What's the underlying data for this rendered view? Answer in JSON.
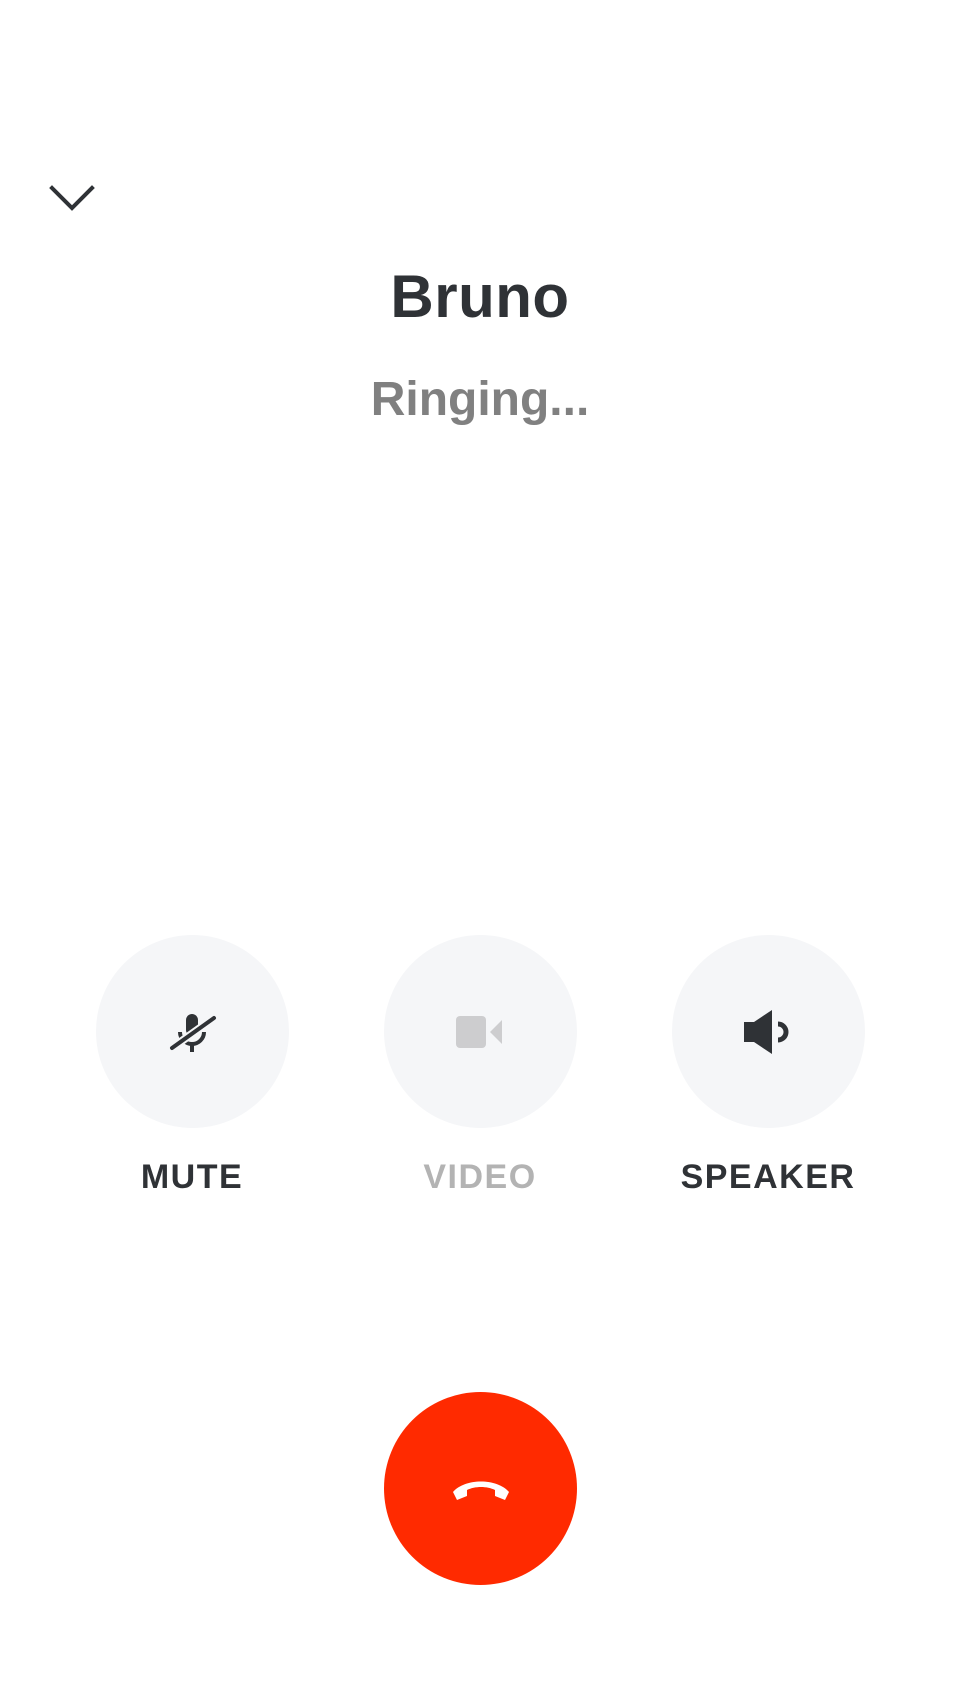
{
  "call": {
    "caller_name": "Bruno",
    "status": "Ringing..."
  },
  "controls": {
    "mute_label": "MUTE",
    "video_label": "VIDEO",
    "speaker_label": "SPEAKER"
  },
  "icons": {
    "collapse": "chevron-down-icon",
    "mute": "microphone-off-icon",
    "video": "video-camera-icon",
    "speaker": "speaker-icon",
    "end_call": "phone-hangup-icon"
  },
  "colors": {
    "end_call": "#ff2a00",
    "control_bg": "#f5f6f8",
    "text_primary": "#2f3236",
    "text_secondary": "#808080",
    "disabled": "#b3b3b3"
  }
}
